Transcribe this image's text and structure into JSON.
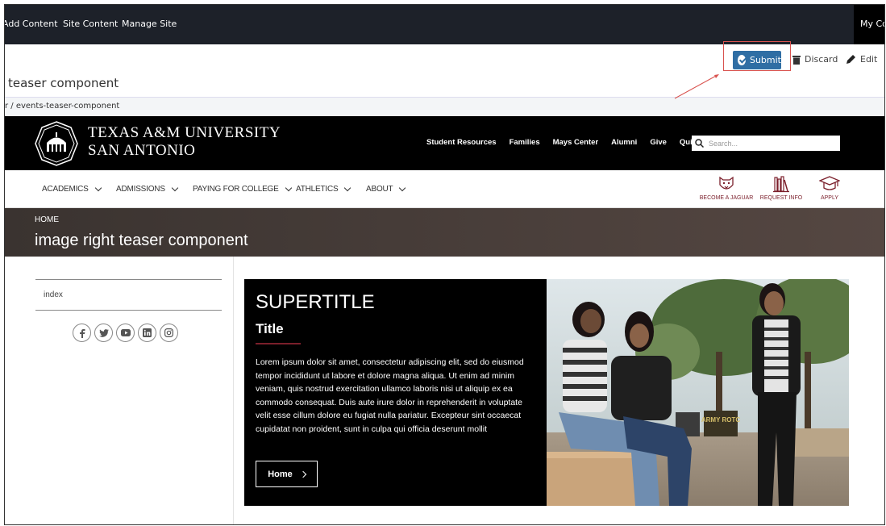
{
  "cms": {
    "menu": [
      "Add Content",
      "Site Content",
      "Manage Site"
    ],
    "account_label": "My Co",
    "toolbar": {
      "submit": "Submit",
      "discard": "Discard",
      "edit": "Edit"
    },
    "page_heading": "teaser component",
    "breadcrumb": "r / events-teaser-component",
    "highlight_color": "#d9534f"
  },
  "site": {
    "name_line1": "TEXAS A&M UNIVERSITY",
    "name_line2": "SAN ANTONIO",
    "util_nav": [
      "Student Resources",
      "Families",
      "Mays Center",
      "Alumni",
      "Give",
      "Quick Links"
    ],
    "search_placeholder": "Search...",
    "main_nav": [
      "ACADEMICS",
      "ADMISSIONS",
      "PAYING FOR COLLEGE",
      "ATHLETICS",
      "ABOUT"
    ],
    "cta": [
      {
        "label": "BECOME A JAGUAR",
        "icon": "jaguar-icon"
      },
      {
        "label": "REQUEST INFO",
        "icon": "books-icon"
      },
      {
        "label": "APPLY",
        "icon": "graduation-cap-icon"
      }
    ],
    "brand_color": "#7b1f2b"
  },
  "hero": {
    "crumb": "HOME",
    "title": "image right teaser component"
  },
  "sidebar": {
    "nav_item": "index",
    "social": [
      "facebook-icon",
      "twitter-icon",
      "youtube-icon",
      "linkedin-icon",
      "instagram-icon"
    ]
  },
  "teaser": {
    "supertitle": "SUPERTITLE",
    "title": "Title",
    "body": "Lorem ipsum dolor sit amet, consectetur adipiscing elit, sed do eiusmod tempor incididunt ut labore et dolore magna aliqua. Ut enim ad minim veniam, quis nostrud exercitation ullamco laboris nisi ut aliquip ex ea commodo consequat. Duis aute irure dolor in reprehenderit in voluptate velit esse cillum dolore eu fugiat nulla pariatur. Excepteur sint occaecat cupidatat non proident, sunt in culpa qui officia deserunt mollit",
    "button": "Home",
    "photo_sign": "ARMY ROTC"
  }
}
